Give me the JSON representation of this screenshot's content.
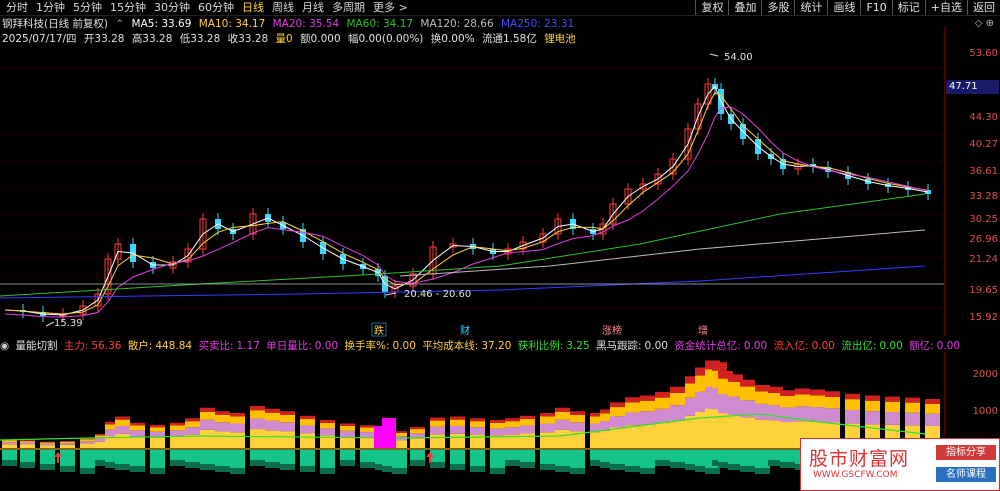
{
  "colors": {
    "up": "#ff3b3b",
    "down": "#3ed6ff",
    "ma5": "#ffffff",
    "ma10": "#ffd23c",
    "ma20": "#e040e0",
    "ma60": "#30c030",
    "ma120": "#bdbdbd",
    "ma250": "#3a3aff",
    "axis": "#e05050"
  },
  "periods": [
    "分时",
    "1分钟",
    "5分钟",
    "15分钟",
    "30分钟",
    "60分钟",
    "日线",
    "周线",
    "月线",
    "多周期",
    "更多 >"
  ],
  "active_period": "日线",
  "toolbar": [
    "复权",
    "叠加",
    "多股",
    "统计",
    "画线",
    "F10",
    "标记",
    "+自选",
    "返回"
  ],
  "header": {
    "stock": "钢拜科技(日线 前复权)",
    "ma5": "MA5: 33.69",
    "ma10": "MA10: 34.17",
    "ma20": "MA20: 35.54",
    "ma60": "MA60: 34.17",
    "ma120": "MA120: 28.66",
    "ma250": "MA250: 23.31"
  },
  "ohlc": {
    "date": "2025/07/17/四",
    "open": "开33.28",
    "high": "高33.28",
    "low": "低33.28",
    "close": "收33.28",
    "vol": "量0",
    "amount": "额0.000",
    "amp": "幅0.00(0.00%)",
    "turnover": "换0.00%",
    "float": "流通1.58亿",
    "concept": "锂电池"
  },
  "price_ticks": [
    "53.60",
    "44.30",
    "40.27",
    "36.61",
    "33.28",
    "30.25",
    "26.96",
    "21.24",
    "19.65",
    "15.92"
  ],
  "current_price": "47.71",
  "annotations": {
    "high": "54.00",
    "low_left": "15.39",
    "range": "20.46 - 20.60"
  },
  "event_tags": [
    "跌",
    "财",
    "涨榜",
    "增"
  ],
  "lower": {
    "title": "量能切割",
    "items": [
      {
        "label": "主力:",
        "value": "56.36"
      },
      {
        "label": "散户:",
        "value": "448.84"
      },
      {
        "label": "买卖比:",
        "value": "1.17"
      },
      {
        "label": "单日量比:",
        "value": "0.00"
      },
      {
        "label": "换手率%:",
        "value": "0.00"
      },
      {
        "label": "平均成本线:",
        "value": "37.20"
      },
      {
        "label": "获利比例:",
        "value": "3.25"
      },
      {
        "label": "黑马跟踪:",
        "value": "0.00"
      },
      {
        "label": "资金统计总亿:",
        "value": "0.00"
      },
      {
        "label": "流入亿:",
        "value": "0.00"
      },
      {
        "label": "流出亿:",
        "value": "0.00"
      },
      {
        "label": "额亿:",
        "value": "0.00"
      }
    ],
    "ticks": [
      "2000",
      "1000"
    ]
  },
  "watermark": {
    "title": "股市财富网",
    "url": "WWW.GSCFW.COM",
    "badge1": "指标分享",
    "badge2": "名师课程"
  }
}
